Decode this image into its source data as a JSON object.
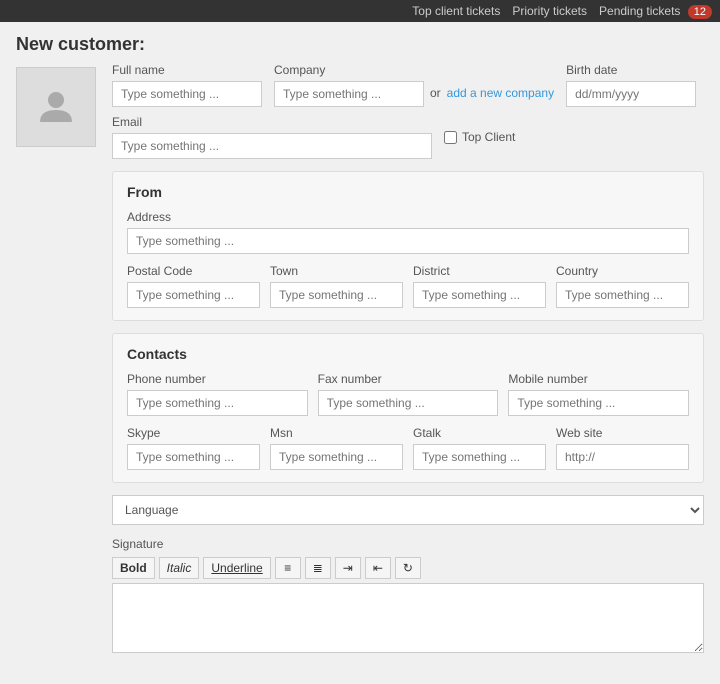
{
  "topnav": {
    "items": [
      {
        "label": "Top client tickets",
        "key": "top-client-tickets"
      },
      {
        "label": "Priority tickets",
        "key": "priority-tickets"
      },
      {
        "label": "Pending tickets",
        "key": "pending-tickets"
      }
    ],
    "pending_badge": "12"
  },
  "page": {
    "title": "New customer:"
  },
  "form": {
    "fullname": {
      "label": "Full name",
      "placeholder": "Type something ..."
    },
    "company": {
      "label": "Company",
      "placeholder": "Type something ..."
    },
    "or_text": "or",
    "add_company_link": "add a new company",
    "birthdate": {
      "label": "Birth date",
      "placeholder": "dd/mm/yyyy"
    },
    "email": {
      "label": "Email",
      "placeholder": "Type something ..."
    },
    "top_client_label": "Top Client",
    "from_section": {
      "title": "From",
      "address": {
        "label": "Address",
        "placeholder": "Type something ..."
      },
      "postal_code": {
        "label": "Postal Code",
        "placeholder": "Type something ..."
      },
      "town": {
        "label": "Town",
        "placeholder": "Type something ..."
      },
      "district": {
        "label": "District",
        "placeholder": "Type something ..."
      },
      "country": {
        "label": "Country",
        "placeholder": "Type something ..."
      }
    },
    "contacts_section": {
      "title": "Contacts",
      "phone": {
        "label": "Phone number",
        "placeholder": "Type something ..."
      },
      "fax": {
        "label": "Fax number",
        "placeholder": "Type something ..."
      },
      "mobile": {
        "label": "Mobile number",
        "placeholder": "Type something ..."
      },
      "skype": {
        "label": "Skype",
        "placeholder": "Type something ..."
      },
      "msn": {
        "label": "Msn",
        "placeholder": "Type something ..."
      },
      "gtalk": {
        "label": "Gtalk",
        "placeholder": "Type something ..."
      },
      "website": {
        "label": "Web site",
        "placeholder": "http://"
      }
    },
    "language": {
      "label": "Language",
      "placeholder": "Language"
    },
    "signature": {
      "label": "Signature",
      "toolbar": {
        "bold": "Bold",
        "italic": "Italic",
        "underline": "Underline"
      }
    }
  }
}
